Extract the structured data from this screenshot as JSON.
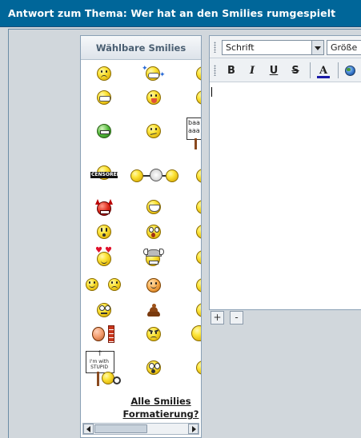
{
  "title": "Antwort zum Thema: Wer hat an den Smilies rumgespielt",
  "smilies_panel": {
    "header": "Wählbare Smilies",
    "all_smilies_link": "Alle Smilies",
    "format_link": "Formatierung?",
    "sign_baaa": "baa aaa",
    "sign_censored": "CENSORED",
    "sign_stupid": "I'm with STUPID"
  },
  "editor": {
    "font_select": "Schrift",
    "size_select": "Größe",
    "buttons": {
      "bold": "B",
      "italic": "I",
      "underline": "U",
      "strike": "S",
      "color": "A"
    },
    "add_button": "+",
    "remove_button": "-"
  },
  "colors": {
    "titlebar": "#006699",
    "background": "#d1d7dc",
    "smiley_yellow": "#fde53a"
  }
}
